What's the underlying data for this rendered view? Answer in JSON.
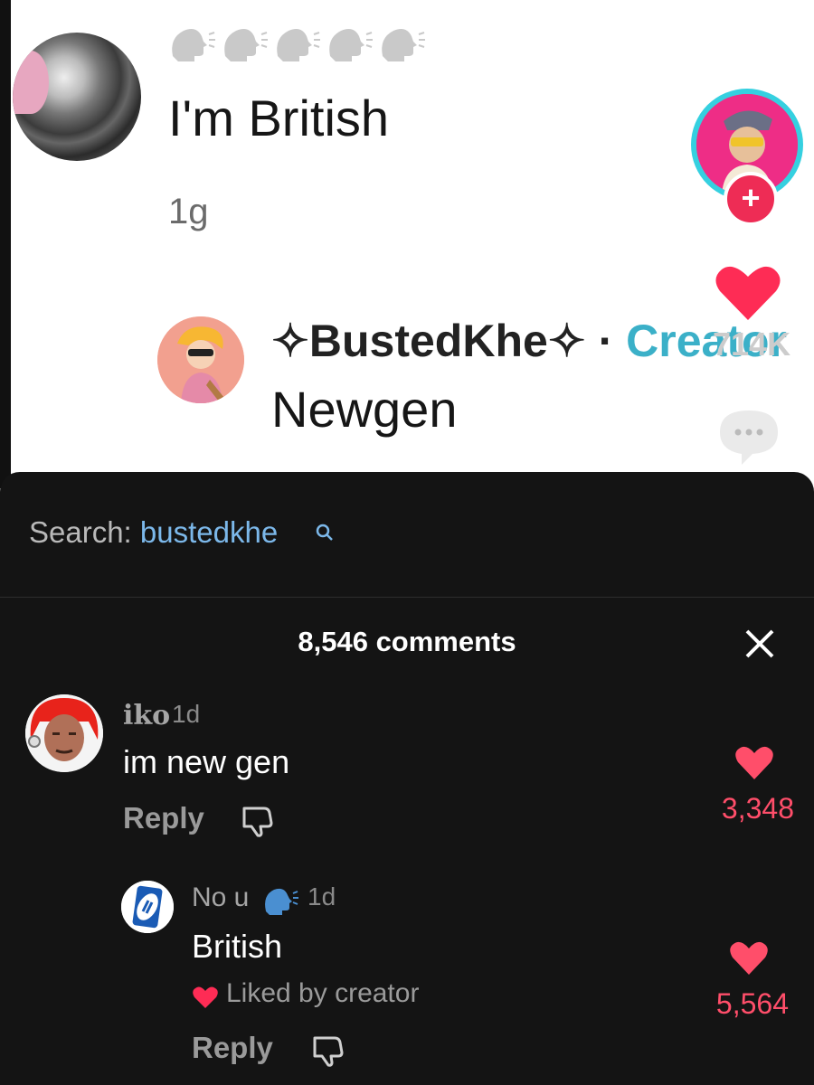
{
  "video": {
    "comment_1": {
      "text": "I'm British",
      "time": "1g"
    },
    "creator_reply": {
      "name": "✧BustedKhe✧",
      "separator": " · ",
      "tag": "Creator",
      "text": "Newgen"
    },
    "actions": {
      "like_count": "714K"
    }
  },
  "search": {
    "prefix": "Search: ",
    "query": "bustedkhe"
  },
  "comments_panel": {
    "title": "8,546 comments",
    "comments": [
      {
        "user": "iko",
        "time": "1d",
        "text": "im new gen",
        "reply_label": "Reply",
        "likes": "3,348"
      }
    ],
    "replies": [
      {
        "user": "No u",
        "time": "1d",
        "text": "British",
        "liked_by": "Liked by creator",
        "reply_label": "Reply",
        "likes": "5,564"
      }
    ]
  },
  "colors": {
    "panel_bg": "#141414",
    "like_red": "#ff4e6a",
    "creator_cyan": "#3bb0c8",
    "search_blue": "#7cb8ea"
  },
  "icons": [
    "speaking-head-icon",
    "plus-icon",
    "heart-icon",
    "comment-bubble-icon",
    "search-icon",
    "close-icon",
    "dislike-icon"
  ]
}
